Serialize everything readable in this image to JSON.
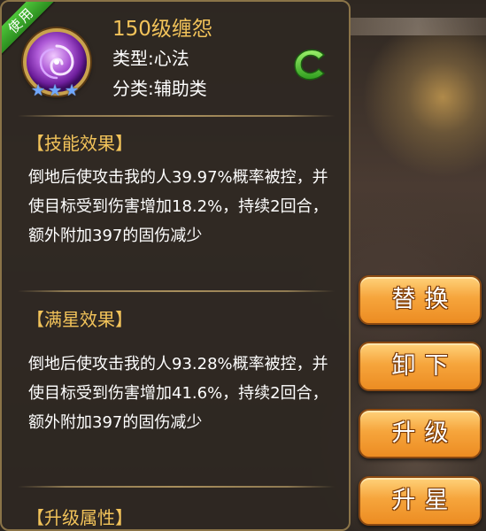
{
  "ribbon_label": "使用",
  "skill": {
    "title": "150级缠怨",
    "type_label": "类型:心法",
    "class_label": "分类:辅助类",
    "icon_name": "swirl-rune-icon",
    "stars": 3
  },
  "badge_icon": "c-letter-badge-icon",
  "sections": [
    {
      "title": "【技能效果】",
      "text": "倒地后使攻击我的人39.97%概率被控，并使目标受到伤害增加18.2%，持续2回合，额外附加397的固伤减少"
    },
    {
      "title": "【满星效果】",
      "text": "倒地后使攻击我的人93.28%概率被控，并使目标受到伤害增加41.6%，持续2回合，额外附加397的固伤减少"
    },
    {
      "title": "【升级属性】"
    }
  ],
  "buttons": {
    "replace": "替换",
    "unequip": "卸下",
    "upgrade": "升级",
    "star_up": "升星"
  },
  "colors": {
    "accent_gold": "#f2c35a",
    "ribbon_green": "#3aa82a",
    "button_orange": "#f6a53c",
    "panel_bg": "#2e2822"
  }
}
